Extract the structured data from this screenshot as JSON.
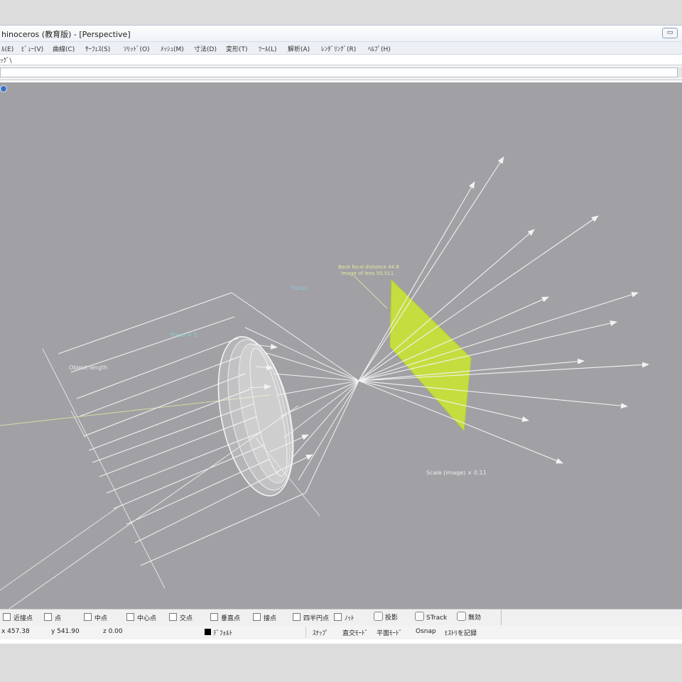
{
  "window": {
    "title": "hinoceros (教育版) - [Perspective]",
    "restore_button": "▭"
  },
  "menu": [
    "ﾙ(E)",
    "ﾋﾞｭｰ(V)",
    "曲線(C)",
    "ｻｰﾌｪｽ(S)",
    "ｿﾘｯﾄﾞ(O)",
    "ﾒｯｼｭ(M)",
    "寸法(D)",
    "変形(T)",
    "ﾂｰﾙ(L)",
    "解析(A)",
    "ﾚﾝﾀﾞﾘﾝｸﾞ(R)",
    "ﾍﾙﾌﾟ(H)"
  ],
  "command_history": "ｯｸﾞ\\",
  "viewport": {
    "name": "Perspective",
    "background": "#a1a0a5",
    "labels": {
      "object_length": "Object length",
      "upper_label_line1": "Back focal distance 44.8",
      "upper_label_line2": "Image of lens 50.511",
      "scale": "Scale (image) × 0.11",
      "lens_tag": "Focal = 1",
      "blue_tag": "Focus"
    },
    "colors": {
      "image_plane": "#c8e13a",
      "rays": "#f2f2f2",
      "lens": "#f7f7f7",
      "cyan_label": "#7fd8d8",
      "yellow_label": "#e6e8a0"
    }
  },
  "osnap": {
    "items": [
      "近接点",
      "点",
      "中点",
      "中心点",
      "交点",
      "垂直点",
      "接点",
      "四半円点",
      "ﾉｯﾄ"
    ],
    "toggles": [
      "投影",
      "STrack",
      "無効"
    ]
  },
  "status": {
    "x": "x 457.38",
    "y": "y 541.90",
    "z": "z 0.00",
    "layer": "ﾃﾞﾌｫﾙﾄ",
    "snap": "ｽﾅｯﾌﾟ",
    "ortho": "直交ﾓｰﾄﾞ",
    "planar": "平面ﾓｰﾄﾞ",
    "osnap": "Osnap",
    "history": "ﾋｽﾄﾘを記録"
  }
}
